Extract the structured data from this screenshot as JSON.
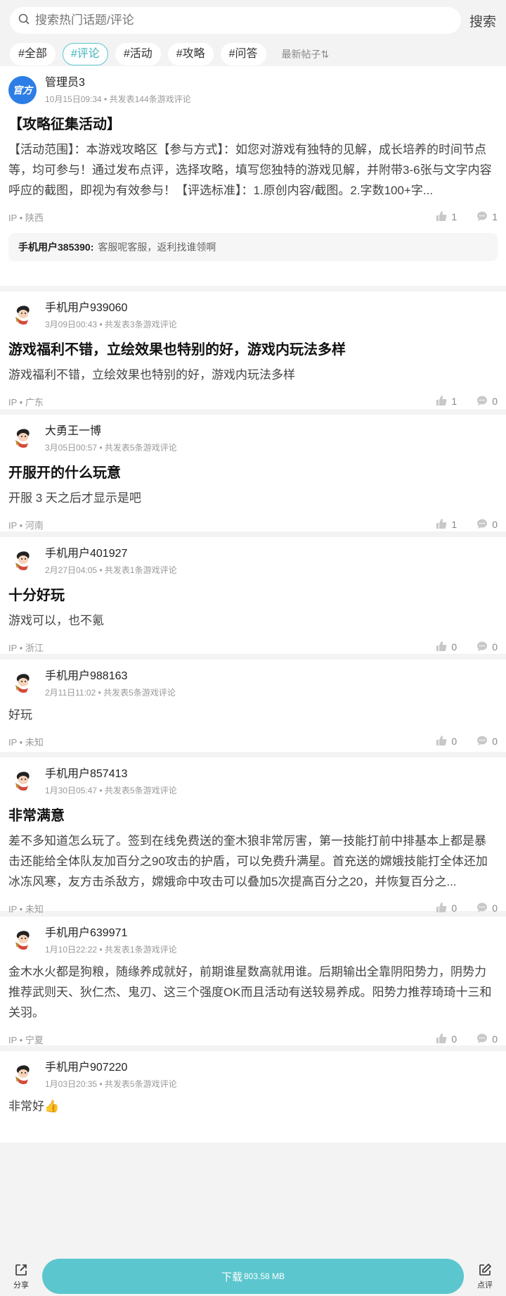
{
  "search": {
    "placeholder": "搜索热门话题/评论",
    "button": "搜索"
  },
  "tags": [
    "#全部",
    "#评论",
    "#活动",
    "#攻略",
    "#问答"
  ],
  "sort_label": "最新帖子",
  "posts": [
    {
      "user": "管理员3",
      "sub": "10月15日09:34 • 共发表144条游戏评论",
      "avatar_text": "官方",
      "title": "【攻略征集活动】",
      "body": "【活动范围】：本游戏攻略区【参与方式】：如您对游戏有独特的见解，成长培养的时间节点等，均可参与！通过发布点评，选择攻略，填写您独特的游戏见解，并附带3-6张与文字内容呼应的截图，即视为有效参与！【评选标准】：1.原创内容/截图。2.字数100+字...",
      "ip": "IP • 陕西",
      "likes": "1",
      "comments": "1",
      "reply_user": "手机用户385390:",
      "reply_text": "客服呢客服，返利找谁领啊"
    },
    {
      "user": "手机用户939060",
      "sub": "3月09日00:43 • 共发表3条游戏评论",
      "title": "游戏福利不错，立绘效果也特别的好，游戏内玩法多样",
      "body": "游戏福利不错，立绘效果也特别的好，游戏内玩法多样",
      "ip": "IP • 广东",
      "likes": "1",
      "comments": "0"
    },
    {
      "user": "大勇王一博",
      "sub": "3月05日00:57 • 共发表5条游戏评论",
      "title": "开服开的什么玩意",
      "body": "开服 3 天之后才显示是吧",
      "ip": "IP • 河南",
      "likes": "1",
      "comments": "0"
    },
    {
      "user": "手机用户401927",
      "sub": "2月27日04:05 • 共发表1条游戏评论",
      "title": "十分好玩",
      "body": "游戏可以，也不氪",
      "ip": "IP • 浙江",
      "likes": "0",
      "comments": "0"
    },
    {
      "user": "手机用户988163",
      "sub": "2月11日11:02 • 共发表5条游戏评论",
      "title": "",
      "body": "好玩",
      "ip": "IP • 未知",
      "likes": "0",
      "comments": "0"
    },
    {
      "user": "手机用户857413",
      "sub": "1月30日05:47 • 共发表5条游戏评论",
      "title": "非常满意",
      "body": "差不多知道怎么玩了。签到在线免费送的奎木狼非常厉害，第一技能打前中排基本上都是暴击还能给全体队友加百分之90攻击的护盾，可以免费升满星。首充送的嫦娥技能打全体还加冰冻风寒，友方击杀敌方，嫦娥命中攻击可以叠加5次提高百分之20，并恢复百分之...",
      "ip": "IP • 未知",
      "likes": "0",
      "comments": "0"
    },
    {
      "user": "手机用户639971",
      "sub": "1月10日22:22 • 共发表1条游戏评论",
      "title": "",
      "body": "金木水火都是狗粮，随缘养成就好，前期谁星数高就用谁。后期输出全靠阴阳势力，阴势力推荐武则天、狄仁杰、鬼刃、这三个强度OK而且活动有送较易养成。阳势力推荐琦琦十三和关羽。",
      "ip": "IP • 宁夏",
      "likes": "0",
      "comments": "0"
    },
    {
      "user": "手机用户907220",
      "sub": "1月03日20:35 • 共发表5条游戏评论",
      "title": "",
      "body": "非常好👍",
      "ip": "",
      "likes": "",
      "comments": ""
    }
  ],
  "bottom": {
    "share": "分享",
    "download": "下载",
    "size": "803.58 MB",
    "review": "点评"
  },
  "colors": {
    "accent": "#5bc6cd",
    "official": "#2c7ee6"
  }
}
